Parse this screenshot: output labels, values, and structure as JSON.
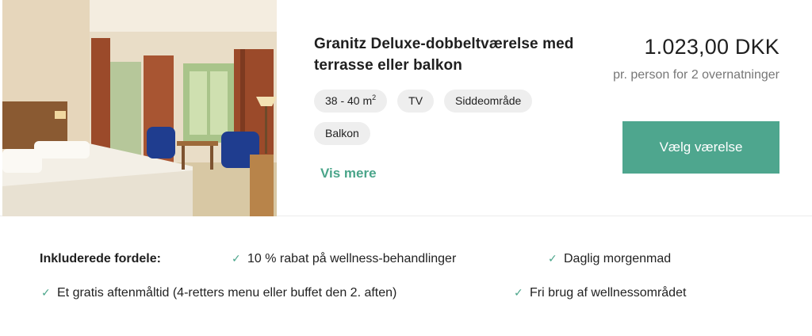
{
  "room": {
    "title": "Granitz Deluxe-dobbeltværelse med terrasse eller balkon",
    "tags": [
      "38 - 40 m",
      "TV",
      "Siddeområde",
      "Balkon"
    ],
    "area_sup": "2",
    "more_label": "Vis mere"
  },
  "price": {
    "amount": "1.023,00 DKK",
    "note": "pr. person for 2 overnatninger",
    "button_label": "Vælg værelse"
  },
  "benefits": {
    "heading": "Inkluderede fordele:",
    "items": [
      "10 % rabat på wellness-behandlinger",
      "Daglig morgenmad",
      "Et gratis aftenmåltid (4-retters menu eller buffet den 2. aften)",
      "Fri brug af wellnessområdet"
    ]
  },
  "icons": {
    "check": "✓",
    "check_color": "#4aa58a"
  },
  "colors": {
    "accent": "#4ea68e"
  }
}
